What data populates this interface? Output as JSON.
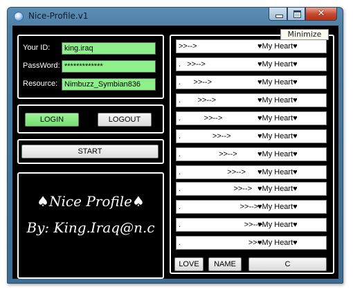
{
  "window": {
    "title": "Nice-Profile.v1"
  },
  "tooltip": {
    "text": "Minimize"
  },
  "title_controls": {
    "close_glyph": "✕"
  },
  "login": {
    "id_label": "Your ID:",
    "id_value": "king.iraq",
    "password_label": "PassWord:",
    "password_value": "*************",
    "resource_label": "Resource:",
    "resource_value": "Nimbuzz_Symbian836",
    "login_button": "LOGIN",
    "logout_button": "LOGOUT",
    "start_button": "START"
  },
  "banner": {
    "line1": "♠Nice Profile♠",
    "line2": "By: King.Iraq@n.c"
  },
  "heart_rows": [
    {
      "prefix": ">>-->",
      "suffix": "♥My Heart♥"
    },
    {
      "prefix": ".   >>-->",
      "suffix": "♥My Heart♥"
    },
    {
      "prefix": ".      >>-->",
      "suffix": "♥My Heart♥"
    },
    {
      "prefix": ".        >>-->",
      "suffix": "♥My Heart♥"
    },
    {
      "prefix": ".           >>-->",
      "suffix": "♥My Heart♥"
    },
    {
      "prefix": ".               >>-->",
      "suffix": "♥My Heart♥"
    },
    {
      "prefix": ".                  >>-->",
      "suffix": "♥My Heart♥"
    },
    {
      "prefix": ".                      >>-->",
      "suffix": "♥My Heart♥"
    },
    {
      "prefix": ".                         >>-->",
      "suffix": "♥My Heart♥"
    },
    {
      "prefix": ".                            >>-->",
      "suffix": "♥My Heart♥"
    },
    {
      "prefix": ".                              >>-->",
      "suffix": "♥My Heart♥"
    },
    {
      "prefix": ".                                >>--",
      "suffix": "♥My Heart♥"
    }
  ],
  "bottom_buttons": {
    "love": "LOVE",
    "name": "NAME",
    "c": "C"
  },
  "icons": [
    "app-icon",
    "minimize-icon",
    "maximize-icon",
    "close-icon"
  ],
  "colors": {
    "field_green": "#8ef08a",
    "client_bg": "#000000",
    "title_bar": "#4d7ea4"
  }
}
